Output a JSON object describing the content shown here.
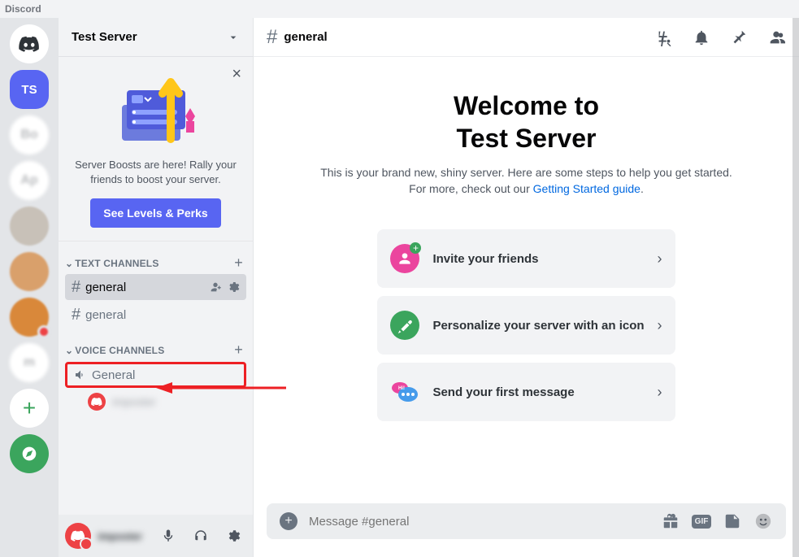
{
  "app_title": "Discord",
  "server": {
    "name": "Test Server",
    "abbrev": "TS"
  },
  "boost": {
    "text": "Server Boosts are here! Rally your friends to boost your server.",
    "button": "See Levels & Perks"
  },
  "sections": {
    "text": "TEXT CHANNELS",
    "voice": "VOICE CHANNELS"
  },
  "channels": {
    "text": [
      {
        "name": "general",
        "active": true
      },
      {
        "name": "general",
        "active": false
      }
    ],
    "voice": [
      {
        "name": "General"
      }
    ]
  },
  "header": {
    "channel": "general"
  },
  "welcome": {
    "line1": "Welcome to",
    "line2": "Test Server",
    "desc_a": "This is your brand new, shiny server. Here are some steps to help you get started. For more, check out our ",
    "desc_link": "Getting Started guide",
    "desc_b": "."
  },
  "cards": [
    {
      "label": "Invite your friends",
      "color": "#eb459e"
    },
    {
      "label": "Personalize your server with an icon",
      "color": "#3ba55d"
    },
    {
      "label": "Send your first message",
      "color": "#faa61a"
    }
  ],
  "msgbar": {
    "placeholder": "Message #general"
  },
  "user": {
    "name": "imposter"
  }
}
